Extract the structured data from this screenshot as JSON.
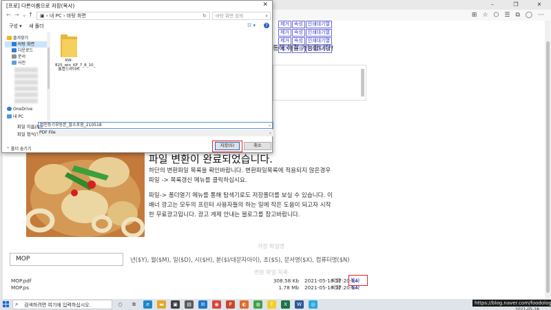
{
  "browser": {
    "toolbar_icons": [
      "reader-icon",
      "favorite-icon",
      "star-icon",
      "collections-icon",
      "profile-icon",
      "more-icon"
    ],
    "window_controls": [
      "–",
      "❐",
      "✕"
    ]
  },
  "file_table_top": {
    "rows": [
      [
        "제거",
        "속성",
        "인쇄대기열"
      ],
      [
        "제거",
        "속성",
        "인쇄대기열"
      ],
      [
        "제거",
        "속성",
        "인쇄대기열"
      ],
      [
        "제거",
        "속성",
        "인쇄대기열"
      ]
    ]
  },
  "page": {
    "notice_partial": "통해 해결 가능합니다!",
    "conversion_title": "파일 변환이 완료되었습니다.",
    "msg1": "하단의 변환파일 목록을 확인바랍니다. 변환파일목록에 적용되지 않은경우",
    "msg2": "파일 -> 목록갱신 메뉴를 클릭하십시요.",
    "msg3": "파일-> 폴더열기 메뉴를 통해 탐색기로도 저장폴더를 보실 수 있습니다. 이",
    "msg4": "배너 광고는 모두의 프린터 사용자들의 하는 일에 작은 도움이 되고자 시작",
    "msg5": "한 무료광고입니다. 광고 게제 안내는 블로그를 참고바랍니다.",
    "save_name_label": "저장 파일명",
    "filename_value": "MOP",
    "filename_hint": "년($Y), 월($M), 일($D), 시($H), 분($I/대문자아이), 초($S), 문서명($X), 컴퓨터명($N)",
    "result_list_label": "변환 파일 목록",
    "files": [
      {
        "name": "MOP.pdf",
        "size": "308.58 Kb",
        "date": "2021-05-18 17:20:14",
        "delete": "삭제",
        "copy": "복사"
      },
      {
        "name": "MOP.ps",
        "size": "1.78 Mb",
        "date": "2021-05-18 17:20:14",
        "delete": "삭제",
        "copy": "복사"
      }
    ]
  },
  "dialog": {
    "title": "[프로] 다른이름으로 저장(복사)",
    "close": "✕",
    "back": "←",
    "forward": "→",
    "up_dropdown": "⌄",
    "up": "↑",
    "address": "▣  ›  내 PC  ›  바탕 화면",
    "refresh": "↻",
    "search_placeholder": "바탕 화면 검색",
    "organize": "구성 ▾",
    "new_folder": "새 폴더",
    "view": "☷ ▾",
    "help": "?",
    "nav": [
      {
        "label": "즐겨찾기",
        "icon_color": "#f2b21c"
      },
      {
        "label": "바탕 화면",
        "icon_color": "#2f7bd8",
        "selected": true
      },
      {
        "label": "다운로드",
        "icon_color": "#2f7bd8"
      },
      {
        "label": "문서",
        "icon_color": "#8f8f8f"
      },
      {
        "label": "사진",
        "icon_color": "#5fa0de"
      }
    ],
    "nav_bottom": [
      {
        "label": "OneDrive",
        "icon_color": "#2f7bd8"
      },
      {
        "label": "내 PC",
        "icon_color": "#4d9ad8"
      }
    ],
    "folder_label": "KW-825_win_KP_7_8_10_통합드라이버",
    "fname_label": "파일 이름(N):",
    "fname_value": "법인등기부등본_말소포함_210518",
    "ftype_label": "파일 형식(T):",
    "ftype_value": "PDF File",
    "hide_folders": "⌃ 폴더 숨기기",
    "save": "저장(S)",
    "cancel": "취소"
  },
  "taskbar": {
    "search_placeholder": "검색하려면 여기에 입력하십시오.",
    "tray_text": "https://blog.naver.com/foodology",
    "date": "2021-05-18",
    "apps": [
      {
        "name": "cortana-icon",
        "glyph": "○",
        "color": "transparent"
      },
      {
        "name": "task-view-icon",
        "glyph": "⧉",
        "color": "transparent"
      },
      {
        "name": "edge-icon",
        "glyph": "e",
        "color": "#1e88c8"
      },
      {
        "name": "explorer-icon",
        "glyph": "▬",
        "color": "#e3a82a"
      },
      {
        "name": "store-icon",
        "glyph": "▣",
        "color": "#3f3f3f"
      },
      {
        "name": "app-icon",
        "glyph": "▤",
        "color": "#5a5a5a"
      },
      {
        "name": "mail-icon",
        "glyph": "✉",
        "color": "#1f78c8"
      },
      {
        "name": "chrome-icon",
        "glyph": "◉",
        "color": "#db4437"
      },
      {
        "name": "powerpoint-icon",
        "glyph": "P",
        "color": "#c9472b"
      },
      {
        "name": "app2-icon",
        "glyph": "◐",
        "color": "#e06b2e"
      },
      {
        "name": "chat-icon",
        "glyph": "◍",
        "color": "#43a047"
      },
      {
        "name": "kakaotalk-icon",
        "glyph": "T",
        "color": "#f2cf25"
      },
      {
        "name": "excel-icon",
        "glyph": "X",
        "color": "#1e7145"
      },
      {
        "name": "word-icon",
        "glyph": "W",
        "color": "#2b579a"
      },
      {
        "name": "app3-icon",
        "glyph": "◎",
        "color": "#2aa8e0"
      }
    ]
  }
}
